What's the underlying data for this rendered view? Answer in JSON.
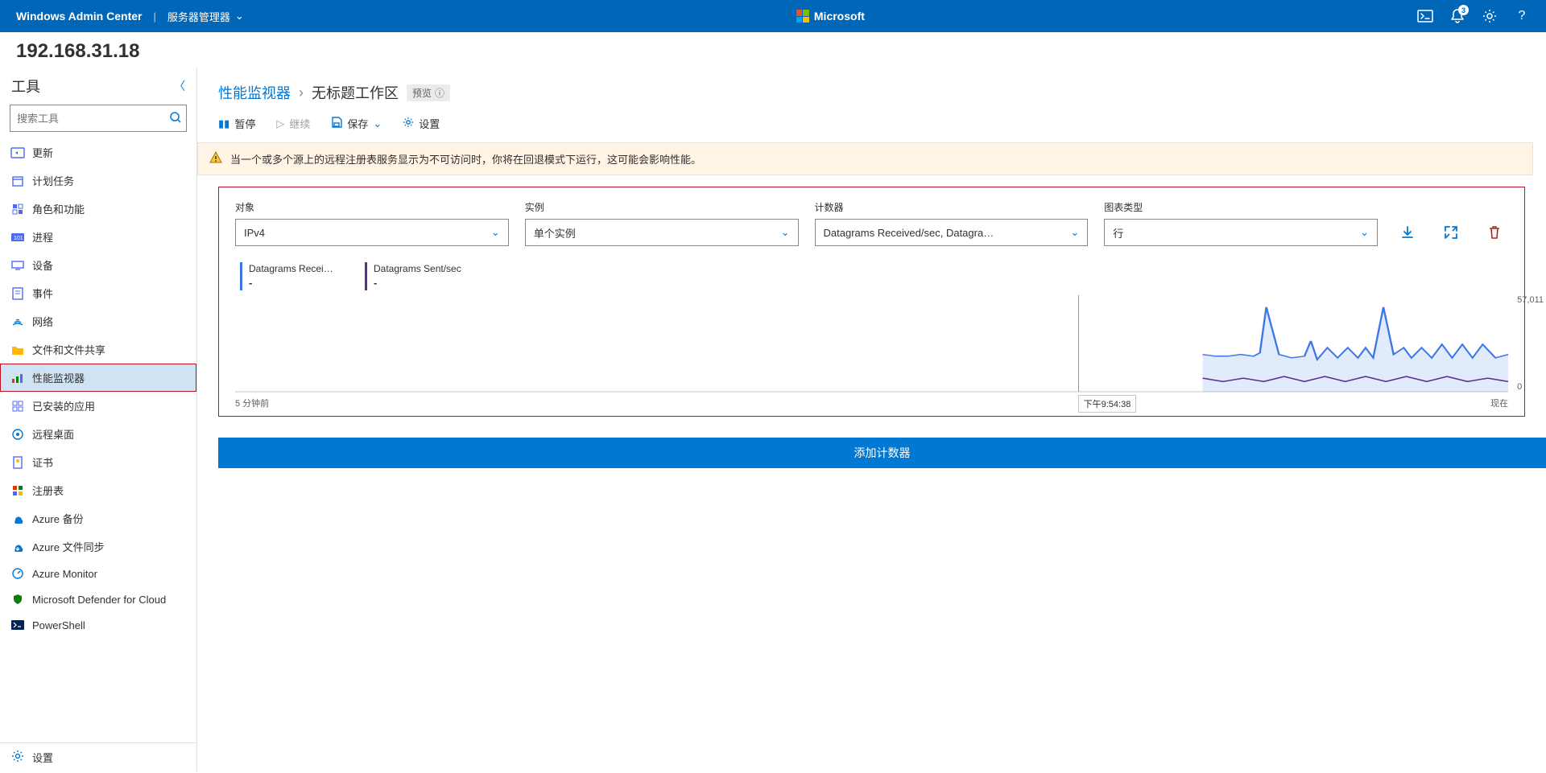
{
  "header": {
    "product": "Windows Admin Center",
    "context": "服务器管理器",
    "brand": "Microsoft",
    "notif_count": "3"
  },
  "server_ip": "192.168.31.18",
  "tools": {
    "title": "工具",
    "search_placeholder": "搜索工具",
    "items": [
      {
        "label": "更新",
        "ico": "update",
        "col": "#4f6bed"
      },
      {
        "label": "计划任务",
        "ico": "calendar",
        "col": "#4f6bed"
      },
      {
        "label": "角色和功能",
        "ico": "features",
        "col": "#4f6bed"
      },
      {
        "label": "进程",
        "ico": "process",
        "col": "#4f6bed"
      },
      {
        "label": "设备",
        "ico": "device",
        "col": "#4f6bed"
      },
      {
        "label": "事件",
        "ico": "events",
        "col": "#4f6bed"
      },
      {
        "label": "网络",
        "ico": "network",
        "col": "#0078d4"
      },
      {
        "label": "文件和文件共享",
        "ico": "files",
        "col": "#ffb900"
      },
      {
        "label": "性能监视器",
        "ico": "perfmon",
        "col": "#4f6bed",
        "sel": true
      },
      {
        "label": "已安装的应用",
        "ico": "apps",
        "col": "#4f6bed"
      },
      {
        "label": "远程桌面",
        "ico": "rdp",
        "col": "#0078d4"
      },
      {
        "label": "证书",
        "ico": "cert",
        "col": "#4f6bed"
      },
      {
        "label": "注册表",
        "ico": "registry",
        "col": "#4f6bed"
      },
      {
        "label": "Azure 备份",
        "ico": "azbackup",
        "col": "#0078d4"
      },
      {
        "label": "Azure 文件同步",
        "ico": "azfile",
        "col": "#0078d4"
      },
      {
        "label": "Azure Monitor",
        "ico": "azmon",
        "col": "#0078d4"
      },
      {
        "label": "Microsoft Defender for Cloud",
        "ico": "defender",
        "col": "#107c10"
      },
      {
        "label": "PowerShell",
        "ico": "ps",
        "col": "#0078d4"
      }
    ],
    "footer": "设置"
  },
  "breadcrumb": {
    "root": "性能监视器",
    "leaf": "无标题工作区",
    "tag": "预览"
  },
  "toolbar": {
    "pause": "暂停",
    "resume": "继续",
    "save": "保存",
    "settings": "设置"
  },
  "warning": "当一个或多个源上的远程注册表服务显示为不可访问时，你将在回退模式下运行，这可能会影响性能。",
  "fields": {
    "object": {
      "label": "对象",
      "value": "IPv4"
    },
    "instance": {
      "label": "实例",
      "value": "单个实例"
    },
    "counter": {
      "label": "计数器",
      "value": "Datagrams Received/sec, Datagrams Sent/sec"
    },
    "chart_type": {
      "label": "图表类型",
      "value": "行"
    }
  },
  "legend": {
    "received": {
      "name": "Datagrams Received/s…",
      "value": "-"
    },
    "sent": {
      "name": "Datagrams Sent/sec",
      "value": "-"
    }
  },
  "timeline": {
    "start": "5 分钟前",
    "marker": "下午9:54:38",
    "end": "现在"
  },
  "yaxis": {
    "max": "57,011",
    "min": "0"
  },
  "add_counter": "添加计数器",
  "chart_data": {
    "type": "line",
    "xlabel": "",
    "ylabel": "",
    "ylim": [
      0,
      57011
    ],
    "x_range_label": [
      "5 分钟前",
      "现在"
    ],
    "marker_x_fraction": 0.662,
    "visible_x_fraction": [
      0.76,
      1.0
    ],
    "series": [
      {
        "name": "Datagrams Received/sec",
        "color": "#3b78e7",
        "area": true,
        "x": [
          0.76,
          0.77,
          0.78,
          0.79,
          0.8,
          0.805,
          0.81,
          0.82,
          0.83,
          0.84,
          0.845,
          0.85,
          0.858,
          0.866,
          0.874,
          0.882,
          0.888,
          0.894,
          0.902,
          0.91,
          0.918,
          0.924,
          0.932,
          0.94,
          0.948,
          0.956,
          0.964,
          0.972,
          0.98,
          0.99,
          1.0
        ],
        "y": [
          22000,
          21000,
          21000,
          22000,
          21000,
          23000,
          50000,
          22000,
          20000,
          21000,
          30000,
          19000,
          26000,
          20000,
          26000,
          20000,
          26000,
          20000,
          50000,
          22000,
          26000,
          20000,
          26000,
          20000,
          28000,
          20000,
          28000,
          20000,
          28000,
          20000,
          22000
        ]
      },
      {
        "name": "Datagrams Sent/sec",
        "color": "#5c2e91",
        "area": false,
        "x": [
          0.76,
          0.776,
          0.792,
          0.808,
          0.824,
          0.84,
          0.856,
          0.872,
          0.888,
          0.904,
          0.92,
          0.936,
          0.952,
          0.968,
          0.984,
          1.0
        ],
        "y": [
          8000,
          6000,
          8000,
          6000,
          9000,
          6000,
          9000,
          6000,
          9000,
          6000,
          9000,
          6000,
          9000,
          6000,
          8000,
          6000
        ]
      }
    ]
  }
}
